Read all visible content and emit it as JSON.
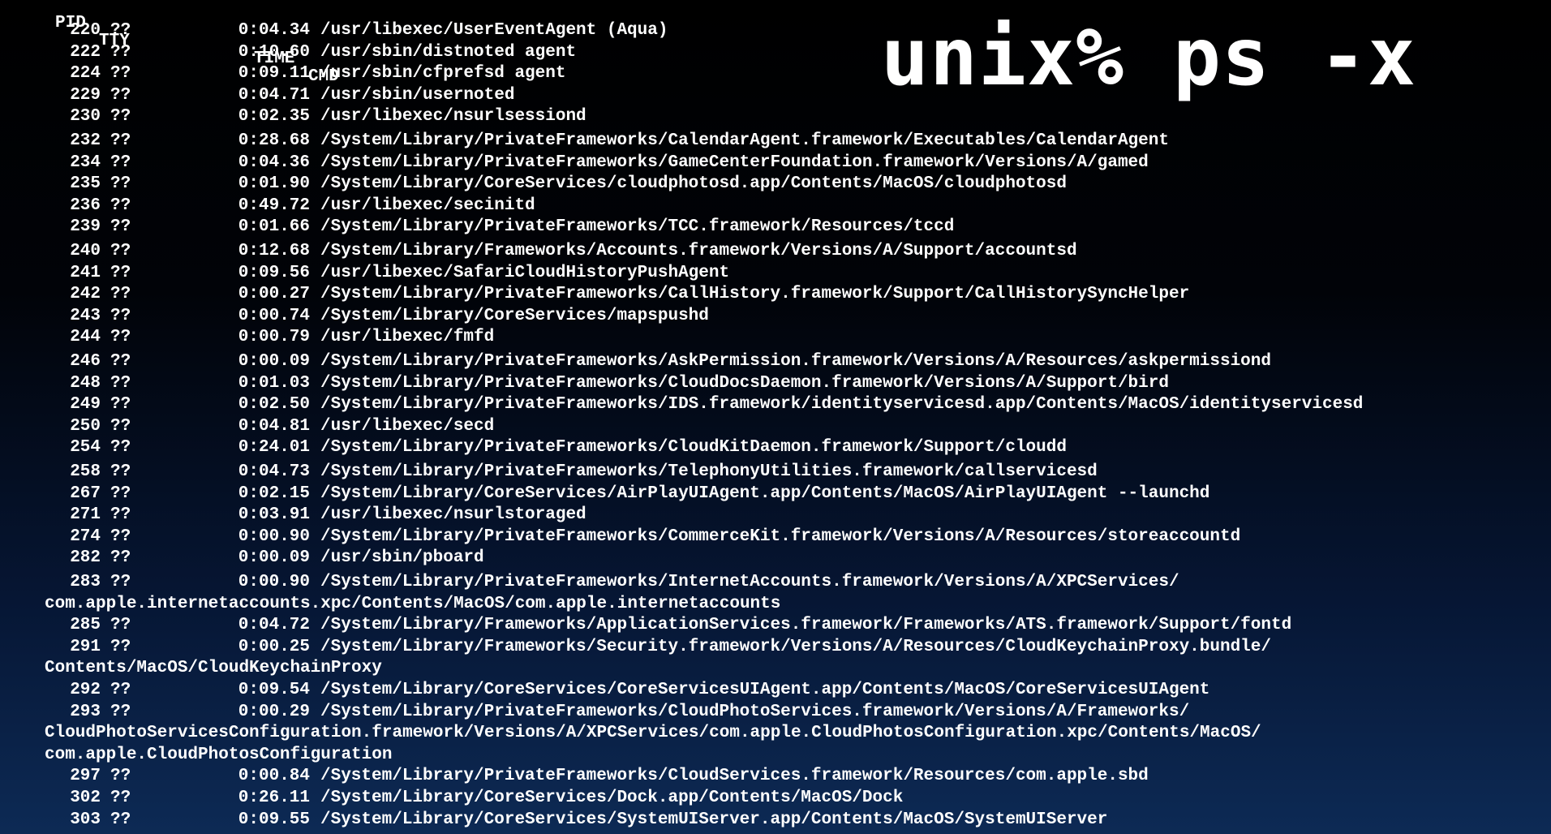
{
  "overlay": {
    "title": "unix% ps -x"
  },
  "header": {
    "pid": "PID",
    "tty": "TTY",
    "time": "TIME",
    "cmd": "CMD"
  },
  "processes": [
    {
      "pid": "220",
      "tty": "??",
      "time": "0:04.34",
      "cmd": "/usr/libexec/UserEventAgent (Aqua)"
    },
    {
      "pid": "222",
      "tty": "??",
      "time": "0:10.60",
      "cmd": "/usr/sbin/distnoted agent"
    },
    {
      "pid": "224",
      "tty": "??",
      "time": "0:09.11",
      "cmd": "/usr/sbin/cfprefsd agent"
    },
    {
      "pid": "229",
      "tty": "??",
      "time": "0:04.71",
      "cmd": "/usr/sbin/usernoted"
    },
    {
      "pid": "230",
      "tty": "??",
      "time": "0:02.35",
      "cmd": "/usr/libexec/nsurlsessiond"
    },
    {
      "pid": "232",
      "tty": "??",
      "time": "0:28.68",
      "cmd": "/System/Library/PrivateFrameworks/CalendarAgent.framework/Executables/CalendarAgent"
    },
    {
      "pid": "234",
      "tty": "??",
      "time": "0:04.36",
      "cmd": "/System/Library/PrivateFrameworks/GameCenterFoundation.framework/Versions/A/gamed"
    },
    {
      "pid": "235",
      "tty": "??",
      "time": "0:01.90",
      "cmd": "/System/Library/CoreServices/cloudphotosd.app/Contents/MacOS/cloudphotosd"
    },
    {
      "pid": "236",
      "tty": "??",
      "time": "0:49.72",
      "cmd": "/usr/libexec/secinitd"
    },
    {
      "pid": "239",
      "tty": "??",
      "time": "0:01.66",
      "cmd": "/System/Library/PrivateFrameworks/TCC.framework/Resources/tccd"
    },
    {
      "pid": "240",
      "tty": "??",
      "time": "0:12.68",
      "cmd": "/System/Library/Frameworks/Accounts.framework/Versions/A/Support/accountsd"
    },
    {
      "pid": "241",
      "tty": "??",
      "time": "0:09.56",
      "cmd": "/usr/libexec/SafariCloudHistoryPushAgent"
    },
    {
      "pid": "242",
      "tty": "??",
      "time": "0:00.27",
      "cmd": "/System/Library/PrivateFrameworks/CallHistory.framework/Support/CallHistorySyncHelper"
    },
    {
      "pid": "243",
      "tty": "??",
      "time": "0:00.74",
      "cmd": "/System/Library/CoreServices/mapspushd"
    },
    {
      "pid": "244",
      "tty": "??",
      "time": "0:00.79",
      "cmd": "/usr/libexec/fmfd"
    },
    {
      "pid": "246",
      "tty": "??",
      "time": "0:00.09",
      "cmd": "/System/Library/PrivateFrameworks/AskPermission.framework/Versions/A/Resources/askpermissiond"
    },
    {
      "pid": "248",
      "tty": "??",
      "time": "0:01.03",
      "cmd": "/System/Library/PrivateFrameworks/CloudDocsDaemon.framework/Versions/A/Support/bird"
    },
    {
      "pid": "249",
      "tty": "??",
      "time": "0:02.50",
      "cmd": "/System/Library/PrivateFrameworks/IDS.framework/identityservicesd.app/Contents/MacOS/identityservicesd"
    },
    {
      "pid": "250",
      "tty": "??",
      "time": "0:04.81",
      "cmd": "/usr/libexec/secd"
    },
    {
      "pid": "254",
      "tty": "??",
      "time": "0:24.01",
      "cmd": "/System/Library/PrivateFrameworks/CloudKitDaemon.framework/Support/cloudd"
    },
    {
      "pid": "258",
      "tty": "??",
      "time": "0:04.73",
      "cmd": "/System/Library/PrivateFrameworks/TelephonyUtilities.framework/callservicesd"
    },
    {
      "pid": "267",
      "tty": "??",
      "time": "0:02.15",
      "cmd": "/System/Library/CoreServices/AirPlayUIAgent.app/Contents/MacOS/AirPlayUIAgent --launchd"
    },
    {
      "pid": "271",
      "tty": "??",
      "time": "0:03.91",
      "cmd": "/usr/libexec/nsurlstoraged"
    },
    {
      "pid": "274",
      "tty": "??",
      "time": "0:00.90",
      "cmd": "/System/Library/PrivateFrameworks/CommerceKit.framework/Versions/A/Resources/storeaccountd"
    },
    {
      "pid": "282",
      "tty": "??",
      "time": "0:00.09",
      "cmd": "/usr/sbin/pboard"
    },
    {
      "pid": "283",
      "tty": "??",
      "time": "0:00.90",
      "cmd": "/System/Library/PrivateFrameworks/InternetAccounts.framework/Versions/A/XPCServices/",
      "cmd_cont": [
        "com.apple.internetaccounts.xpc/Contents/MacOS/com.apple.internetaccounts"
      ]
    },
    {
      "pid": "285",
      "tty": "??",
      "time": "0:04.72",
      "cmd": "/System/Library/Frameworks/ApplicationServices.framework/Frameworks/ATS.framework/Support/fontd"
    },
    {
      "pid": "291",
      "tty": "??",
      "time": "0:00.25",
      "cmd": "/System/Library/Frameworks/Security.framework/Versions/A/Resources/CloudKeychainProxy.bundle/",
      "cmd_cont": [
        "Contents/MacOS/CloudKeychainProxy"
      ]
    },
    {
      "pid": "292",
      "tty": "??",
      "time": "0:09.54",
      "cmd": "/System/Library/CoreServices/CoreServicesUIAgent.app/Contents/MacOS/CoreServicesUIAgent"
    },
    {
      "pid": "293",
      "tty": "??",
      "time": "0:00.29",
      "cmd": "/System/Library/PrivateFrameworks/CloudPhotoServices.framework/Versions/A/Frameworks/",
      "cmd_cont": [
        "CloudPhotoServicesConfiguration.framework/Versions/A/XPCServices/com.apple.CloudPhotosConfiguration.xpc/Contents/MacOS/",
        "com.apple.CloudPhotosConfiguration"
      ]
    },
    {
      "pid": "297",
      "tty": "??",
      "time": "0:00.84",
      "cmd": "/System/Library/PrivateFrameworks/CloudServices.framework/Resources/com.apple.sbd"
    },
    {
      "pid": "302",
      "tty": "??",
      "time": "0:26.11",
      "cmd": "/System/Library/CoreServices/Dock.app/Contents/MacOS/Dock"
    },
    {
      "pid": "303",
      "tty": "??",
      "time": "0:09.55",
      "cmd": "/System/Library/CoreServices/SystemUIServer.app/Contents/MacOS/SystemUIServer"
    }
  ]
}
